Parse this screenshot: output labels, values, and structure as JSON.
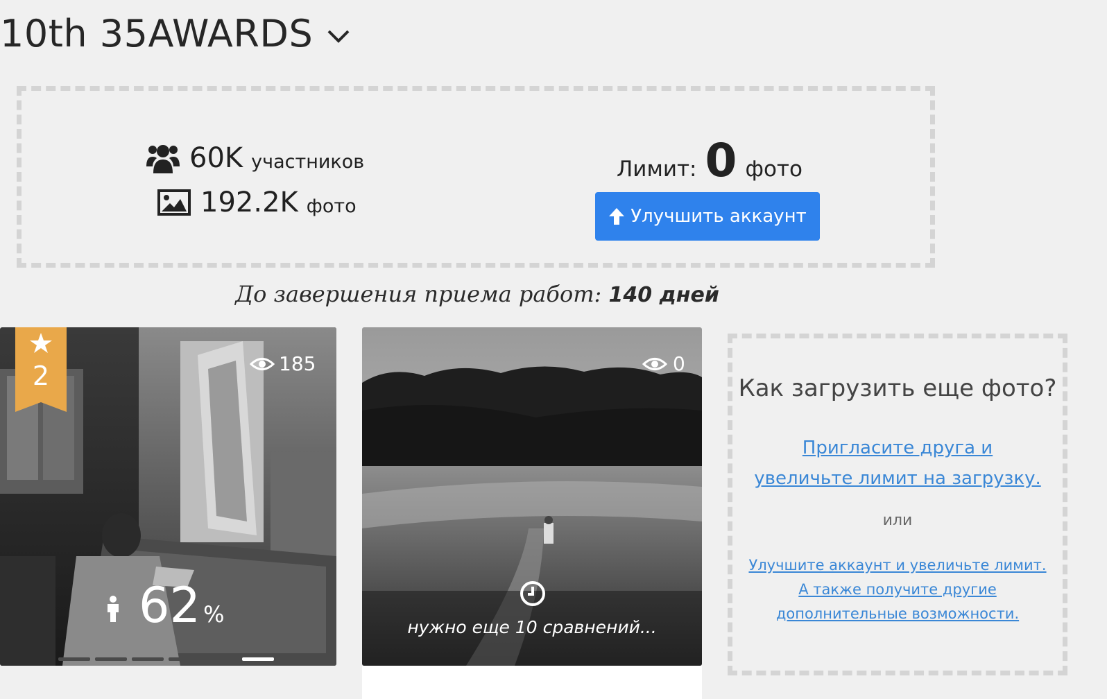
{
  "header": {
    "title": "10th 35AWARDS"
  },
  "stats": {
    "participants_value": "60K",
    "participants_unit": "участников",
    "photos_value": "192.2K",
    "photos_unit": "фото"
  },
  "limit": {
    "label": "Лимит:",
    "value": "0",
    "unit": "фото"
  },
  "upgrade_button": {
    "label": "Улучшить аккаунт"
  },
  "deadline": {
    "label": "До завершения приема работ:",
    "value": "140 дней"
  },
  "photos": [
    {
      "rank": "2",
      "views": "185",
      "score": "62",
      "score_unit": "%",
      "progress_steps": 6,
      "progress_active": 6
    },
    {
      "views": "0",
      "status": "нужно еще 10 сравнений..."
    }
  ],
  "upload_info": {
    "title": "Как загрузить еще фото?",
    "invite_link": "Пригласите друга и увеличьте лимит на загрузку.",
    "or": "или",
    "upgrade_link": "Улучшите аккаунт и увеличьте лимит. А также получите другие дополнительные возможности."
  },
  "colors": {
    "accent": "#2f82ec",
    "ribbon": "#e9a84a",
    "link": "#3a87d6",
    "dashed_border": "#d4d4d4"
  }
}
